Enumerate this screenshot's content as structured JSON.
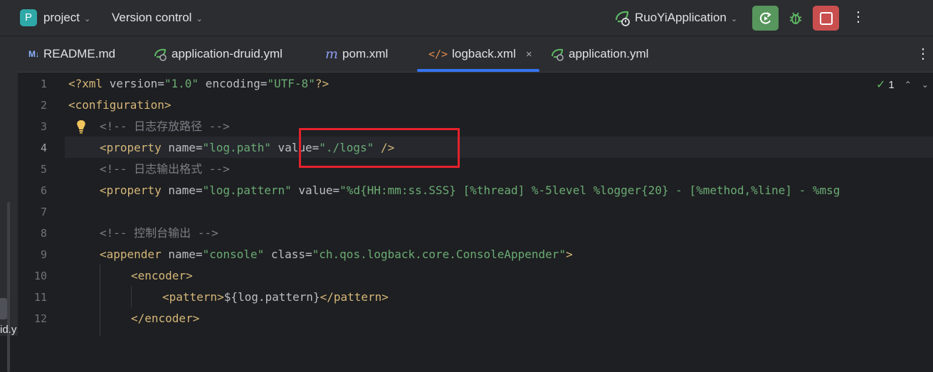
{
  "titlebar": {
    "project_badge": "P",
    "project_name": "project",
    "vcs_label": "Version control",
    "run_config": "RuoYiApplication",
    "icons": [
      "spring-boot-icon",
      "rerun-icon",
      "debug-icon",
      "stop-icon",
      "more-options-icon"
    ],
    "colors": {
      "rerun_bg": "#57965c",
      "stop_bg": "#c94f4f",
      "project_badge": "#2fa8a8"
    }
  },
  "left_strip": {
    "partial_text": "id.y"
  },
  "tabs": [
    {
      "label": "README.md",
      "icon": "markdown-icon",
      "icon_text": "M↓",
      "active": false
    },
    {
      "label": "application-druid.yml",
      "icon": "spring-yaml-icon",
      "active": false
    },
    {
      "label": "pom.xml",
      "icon": "maven-icon",
      "icon_text": "m",
      "active": false
    },
    {
      "label": "logback.xml",
      "icon": "xml-icon",
      "icon_text": "</>",
      "active": true,
      "close": "×"
    },
    {
      "label": "application.yml",
      "icon": "spring-yaml-icon",
      "active": false
    }
  ],
  "editor": {
    "inspection_count": "1",
    "current_line": 4,
    "line_numbers": [
      "1",
      "2",
      "3",
      "4",
      "5",
      "6",
      "7",
      "8",
      "9",
      "10",
      "11",
      "12"
    ],
    "lines": {
      "l1": {
        "a": "<?xml ",
        "b": "version",
        "c": "=",
        "d": "\"1.0\"",
        "e": " encoding",
        "f": "=",
        "g": "\"UTF-8\"",
        "h": "?>"
      },
      "l2": {
        "a": "<configuration>"
      },
      "l3": {
        "a": "<!-- 日志存放路径 -->"
      },
      "l4": {
        "a": "<property ",
        "b": "name",
        "c": "=",
        "d": "\"log.path\"",
        "e": " value",
        "f": "=",
        "g": "\"./logs\"",
        "h": " />"
      },
      "l5": {
        "a": "<!-- 日志输出格式 -->"
      },
      "l6": {
        "a": "<property ",
        "b": "name",
        "c": "=",
        "d": "\"log.pattern\"",
        "e": " value",
        "f": "=",
        "g": "\"%d{HH:mm:ss.SSS} [%thread] %-5level %logger{20} - [%method,%line] - %msg"
      },
      "l8": {
        "a": "<!-- 控制台输出 -->"
      },
      "l9": {
        "a": "<appender ",
        "b": "name",
        "c": "=",
        "d": "\"console\"",
        "e": " class",
        "f": "=",
        "g": "\"ch.qos.logback.core.ConsoleAppender\"",
        "h": ">"
      },
      "l10": {
        "a": "<encoder>"
      },
      "l11": {
        "a": "<pattern>",
        "b": "${log.pattern}",
        "c": "</pattern>"
      },
      "l12": {
        "a": "</encoder>"
      }
    }
  },
  "annotation": {
    "highlight_color": "#e5222d"
  }
}
